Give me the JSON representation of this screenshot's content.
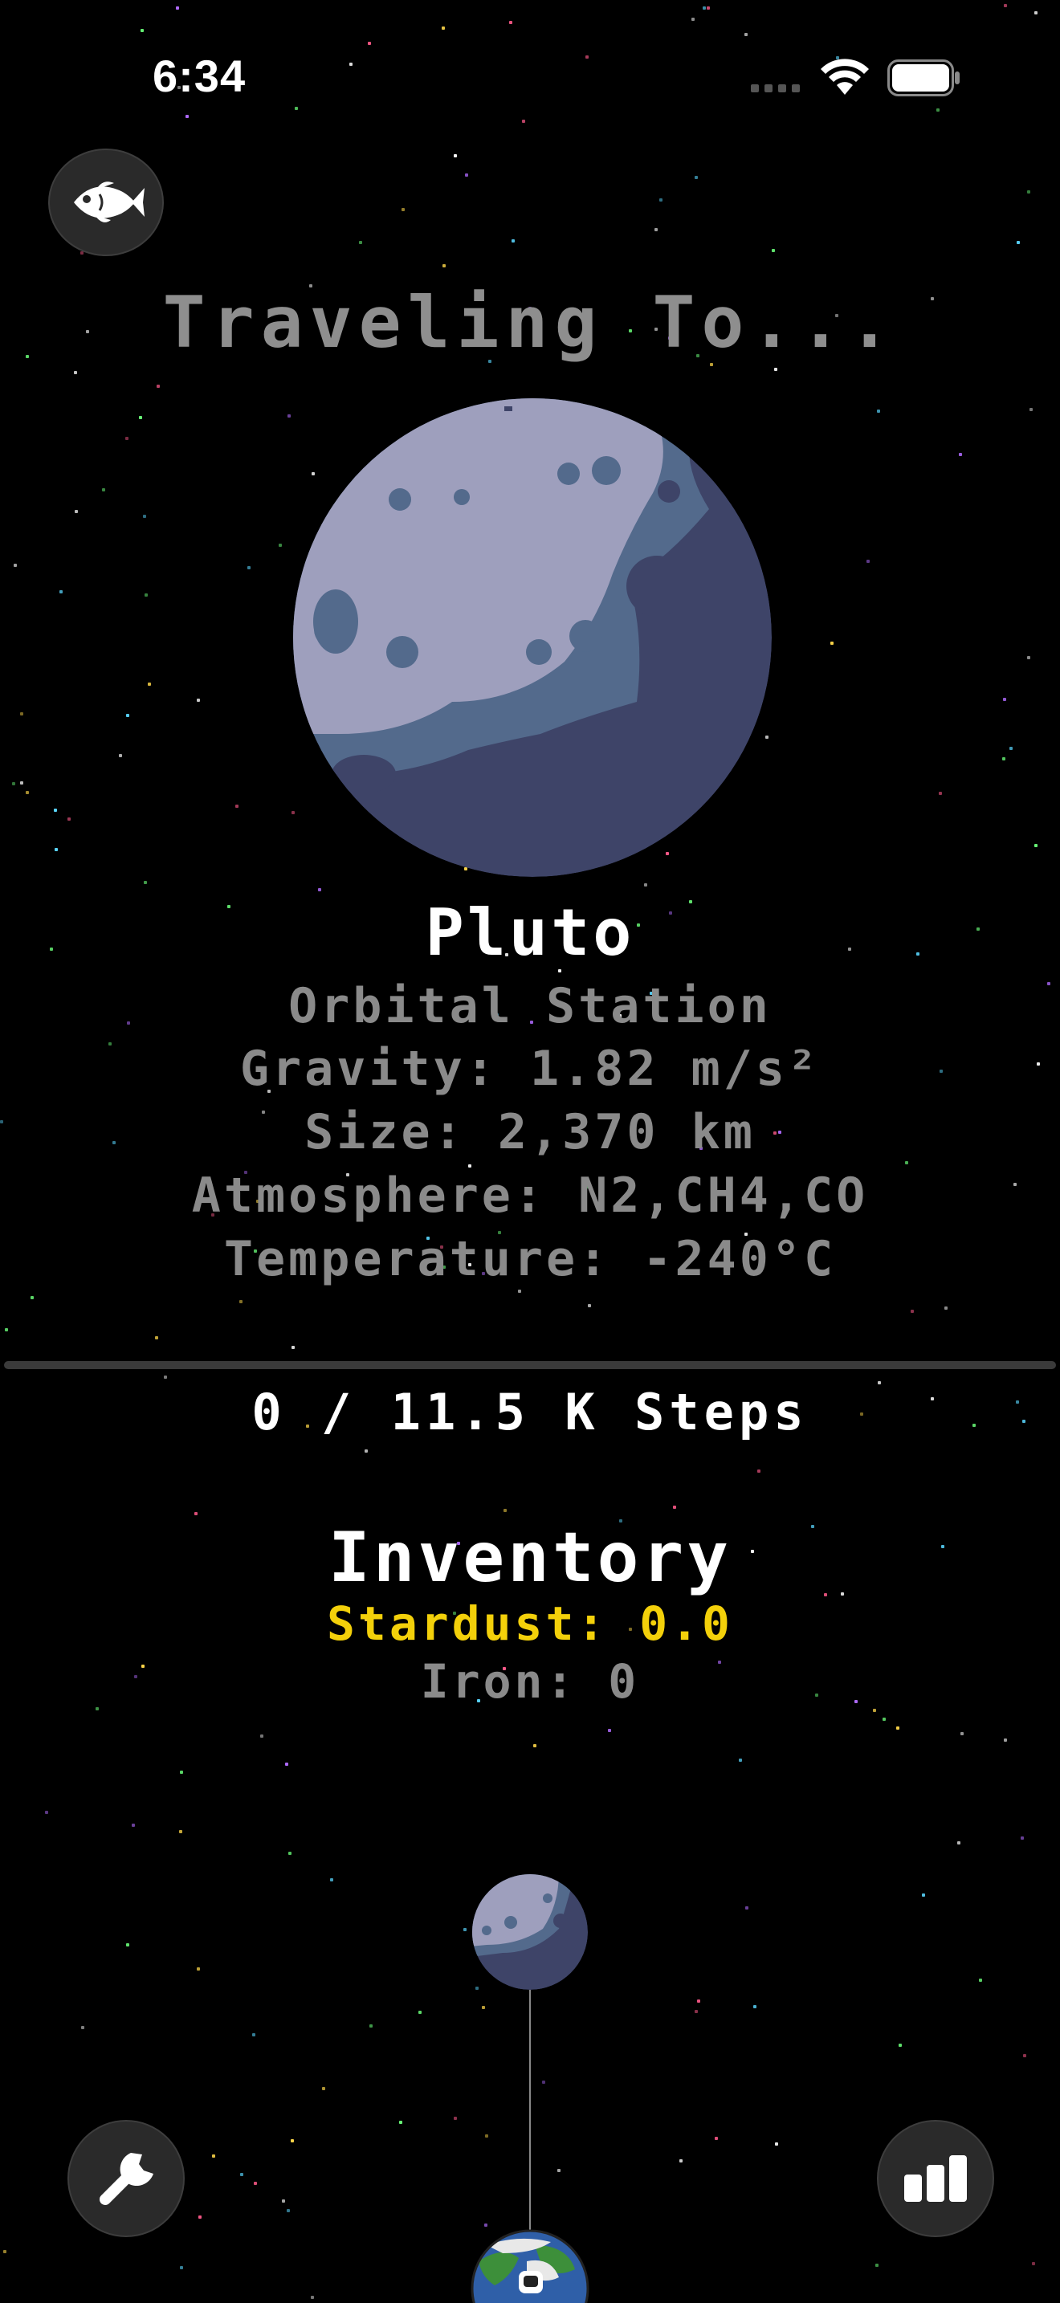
{
  "status_bar": {
    "time": "6:34"
  },
  "buttons": {
    "fish_icon": "fish-icon",
    "wrench_icon": "wrench-icon",
    "stats_icon": "bar-chart-icon"
  },
  "header": {
    "title": "Traveling To..."
  },
  "destination": {
    "name": "Pluto",
    "type": "Orbital Station",
    "gravity": "Gravity: 1.82 m/s²",
    "size": "Size: 2,370 km",
    "atmosphere": "Atmosphere: N2,CH4,CO",
    "temperature": "Temperature: -240°C"
  },
  "progress": {
    "fraction": 0,
    "label": "0 / 11.5 K Steps"
  },
  "inventory": {
    "title": "Inventory",
    "stardust": "Stardust: 0.0",
    "iron": "Iron: 0"
  },
  "colors": {
    "background": "#000000",
    "stardust": "#f3d00a",
    "muted_text": "#8a8a8a"
  }
}
